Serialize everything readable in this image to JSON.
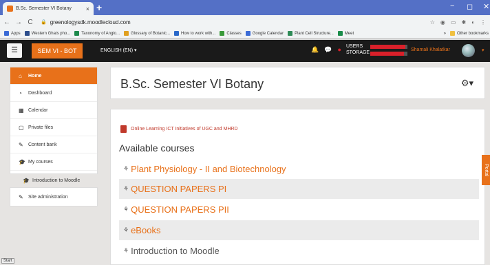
{
  "browser": {
    "tab_title": "B.Sc. Semester VI Botany",
    "tab_close": "×",
    "new_tab": "+",
    "url": "greenologysdk.moodlecloud.com",
    "window_controls": [
      "−",
      "◻",
      "✕"
    ],
    "bookmarks": [
      {
        "label": "Apps",
        "color": "#3b6bd6"
      },
      {
        "label": "Western Ghats pho...",
        "color": "#2c4d8c"
      },
      {
        "label": "Taxonomy of Angio...",
        "color": "#1d8a4c"
      },
      {
        "label": "Glossary of Botanic...",
        "color": "#e0a020"
      },
      {
        "label": "How to work with...",
        "color": "#2a69c9"
      },
      {
        "label": "Classes",
        "color": "#3a9a3a"
      },
      {
        "label": "Google Calendar",
        "color": "#3b6bd6"
      },
      {
        "label": "Plant Cell Structure...",
        "color": "#2e8b57"
      },
      {
        "label": "Meet",
        "color": "#1a8c4a"
      }
    ],
    "bookmarks_more": "»",
    "other_bookmarks": "Other bookmarks"
  },
  "navbar": {
    "brand": "SEM VI - BOT",
    "language": "ENGLISH (EN) ▾",
    "usage_users": "USERS",
    "usage_storage": "STORAGE",
    "users_fill": 0.95,
    "storage_fill": 0.9,
    "user_name": "Shamali Khalatkar",
    "accent": "#e8711a"
  },
  "sidebar": {
    "items": [
      {
        "label": "Home",
        "icon": "home-icon",
        "glyph": "⌂"
      },
      {
        "label": "Dashboard",
        "icon": "dashboard-icon",
        "glyph": "◔"
      },
      {
        "label": "Calendar",
        "icon": "calendar-icon",
        "glyph": "▦"
      },
      {
        "label": "Private files",
        "icon": "file-icon",
        "glyph": "▢"
      },
      {
        "label": "Content bank",
        "icon": "brush-icon",
        "glyph": "✎"
      },
      {
        "label": "My courses",
        "icon": "graduation-cap-icon",
        "glyph": "🎓"
      },
      {
        "label": "Introduction to Moodle",
        "icon": "graduation-cap-icon",
        "glyph": "🎓"
      }
    ],
    "admin": {
      "label": "Site administration",
      "icon": "wrench-icon",
      "glyph": "🔧"
    }
  },
  "main": {
    "title": "B.Sc. Semester VI Botany",
    "notice": "Online Learning ICT Initiatives of UGC and MHRD",
    "available": "Available courses",
    "courses": [
      "Plant Physiology - II and Biotechnology",
      "QUESTION PAPERS PI",
      "QUESTION PAPERS PII",
      "eBooks",
      "Introduction to Moodle"
    ]
  },
  "portal_tab": "Portal",
  "status_text": "Start"
}
